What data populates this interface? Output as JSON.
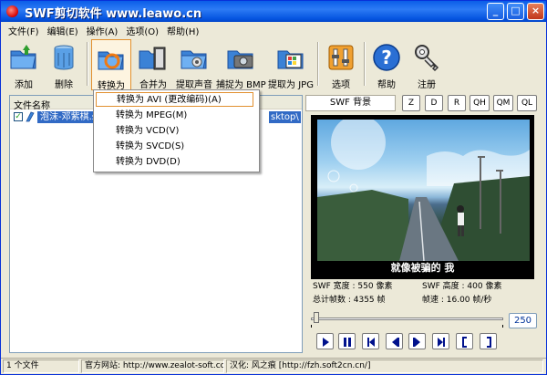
{
  "window": {
    "title": "SWF剪切软件 www.leawo.cn",
    "minimize": "_",
    "maximize": "□",
    "close": "×"
  },
  "menu": [
    "文件(F)",
    "编辑(E)",
    "操作(A)",
    "选项(O)",
    "帮助(H)"
  ],
  "toolbar": {
    "add": "添加",
    "delete": "删除",
    "convert": "转换为",
    "merge": "合并为",
    "extract_audio": "提取声音",
    "capture_bmp": "捕捉为 BMP",
    "extract_jpg": "提取为 JPG",
    "options": "选项",
    "help": "帮助",
    "register": "注册"
  },
  "dropdown": [
    "转换为 AVI (更改编码)(A)",
    "转换为 MPEG(M)",
    "转换为 VCD(V)",
    "转换为 SVCD(S)",
    "转换为 DVD(D)"
  ],
  "list": {
    "header": "文件名称",
    "row_name": "泡沫-邓紫棋.s",
    "row_path": "sktop\\",
    "checked": "✓"
  },
  "right": {
    "tab": "SWF 背景",
    "buttons": [
      "Z",
      "D",
      "R",
      "QH",
      "QM",
      "QL"
    ],
    "caption": "就像被骗的 我",
    "width": "SWF 宽度 : 550 像素",
    "height": "SWF 高度 : 400 像素",
    "frames": "总计帧数 : 4355 帧",
    "fps": "帧速 : 16.00 帧/秒",
    "counter": "250"
  },
  "status": [
    "1 个文件",
    "官方网站: http://www.zealot-soft.cc",
    "汉化: 风之痕 [http://fzh.soft2cn.cn/]"
  ],
  "colors": {
    "titlebar": "#0a5de8",
    "selection": "#316ac5",
    "accent": "#e2902f"
  }
}
